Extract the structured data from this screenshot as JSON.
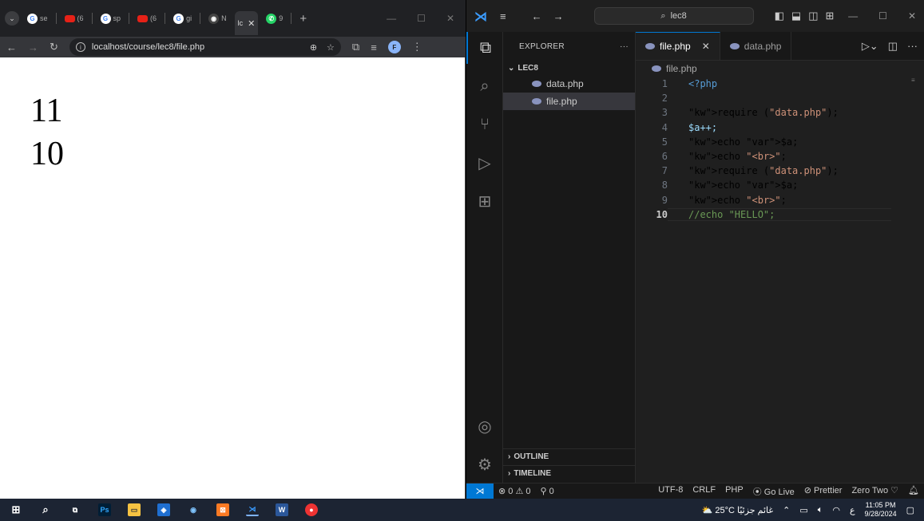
{
  "browser": {
    "tabs": [
      {
        "favicon": "google",
        "label": "se"
      },
      {
        "favicon": "youtube",
        "label": "(6"
      },
      {
        "favicon": "google",
        "label": "sp"
      },
      {
        "favicon": "youtube",
        "label": "(6"
      },
      {
        "favicon": "google",
        "label": "gi"
      },
      {
        "favicon": "github",
        "label": "N"
      },
      {
        "favicon": "page",
        "label": "lc",
        "active": true
      },
      {
        "favicon": "whatsapp",
        "label": "9"
      }
    ],
    "url": "localhost/course/lec8/file.php",
    "output_lines": [
      "11",
      "10"
    ]
  },
  "vscode": {
    "search_text": "lec8",
    "explorer": {
      "title": "EXPLORER",
      "folder": "LEC8",
      "files": [
        "data.php",
        "file.php"
      ],
      "outline": "OUTLINE",
      "timeline": "TIMELINE"
    },
    "tabs": [
      {
        "label": "file.php",
        "active": true
      },
      {
        "label": "data.php",
        "active": false
      }
    ],
    "breadcrumb": "file.php",
    "code_lines": [
      {
        "n": "1",
        "text": "<?php"
      },
      {
        "n": "2",
        "text": ""
      },
      {
        "n": "3",
        "text": "require (\"data.php\");"
      },
      {
        "n": "4",
        "text": "$a++;"
      },
      {
        "n": "5",
        "text": "echo $a;"
      },
      {
        "n": "6",
        "text": "echo \"<br>\";"
      },
      {
        "n": "7",
        "text": "require (\"data.php\");"
      },
      {
        "n": "8",
        "text": "echo $a;"
      },
      {
        "n": "9",
        "text": "echo \"<br>\";"
      },
      {
        "n": "10",
        "text": "//echo \"HELLO\";"
      }
    ],
    "status": {
      "errors": "0",
      "warnings": "0",
      "ports": "0",
      "encoding": "UTF-8",
      "eol": "CRLF",
      "language": "PHP",
      "golive": "Go Live",
      "prettier": "Prettier",
      "theme": "Zero Two"
    }
  },
  "taskbar": {
    "weather": "25°C",
    "weather_text": "غائم جزئيًا",
    "lang": "ع",
    "time": "11:05 PM",
    "date": "9/28/2024"
  }
}
